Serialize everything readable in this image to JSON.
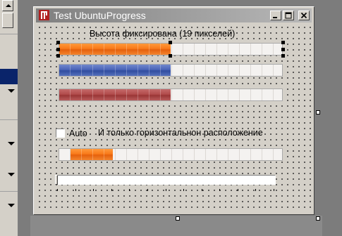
{
  "window": {
    "title": "Test UbuntuProgress",
    "buttons": [
      "minimize",
      "maximize",
      "close"
    ]
  },
  "form": {
    "fixed_height_label": "Высота фиксирована (19 пикселей)",
    "auto_checkbox": {
      "label": "Auto",
      "checked": false
    },
    "horizontal_label": "И только горизонтальнон расположение",
    "progress_bars": [
      {
        "name": "orange",
        "color": "#f97a1a",
        "fraction": 0.5,
        "selected": true
      },
      {
        "name": "blue",
        "color": "#3f5aac",
        "fraction": 0.5
      },
      {
        "name": "red",
        "color": "#a84242",
        "fraction": 0.5
      },
      {
        "name": "marquee",
        "color": "#f97a1a",
        "fraction": 0.19,
        "marquee_start": 0.05
      }
    ],
    "slider": {
      "value": 0,
      "tick_count": 13
    }
  },
  "icons": {
    "app": "app-icon",
    "minimize": "minimize-icon",
    "maximize": "maximize-icon",
    "close": "close-icon"
  }
}
